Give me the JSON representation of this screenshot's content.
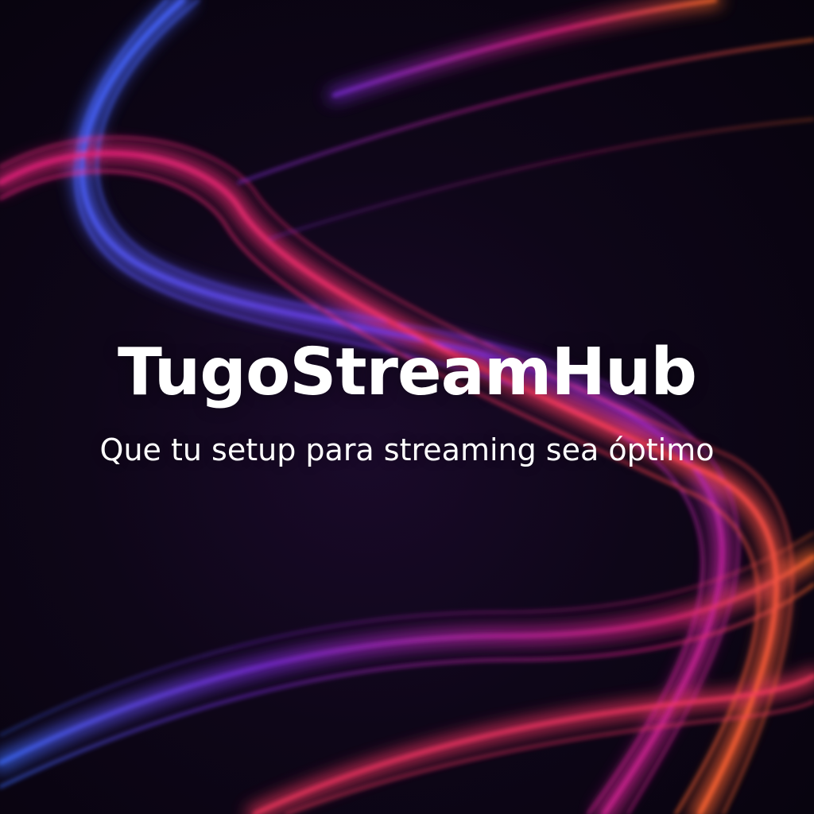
{
  "brand": {
    "title": "TugoStreamHub",
    "tagline": "Que tu setup para streaming sea óptimo"
  },
  "colors": {
    "background": "#0b0514",
    "title_text": "#ffffff",
    "tagline_text": "#ffffff",
    "wave_blue": "#3d6bff",
    "wave_magenta": "#e0207a",
    "wave_purple": "#7a2bd6",
    "wave_orange": "#ff6a2a"
  },
  "decoration": {
    "name": "glowing-light-waves"
  }
}
